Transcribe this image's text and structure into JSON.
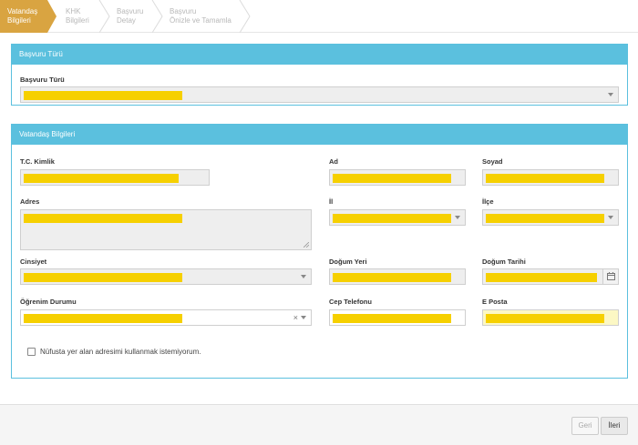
{
  "steps": [
    {
      "line1": "Vatandaş",
      "line2": "Bilgileri",
      "active": true
    },
    {
      "line1": "KHK",
      "line2": "Bilgileri",
      "active": false
    },
    {
      "line1": "Başvuru",
      "line2": "Detay",
      "active": false
    },
    {
      "line1": "Başvuru",
      "line2": "Önizle ve Tamamla",
      "active": false
    }
  ],
  "application_panel": {
    "title": "Başvuru Türü",
    "field_label": "Başvuru Türü"
  },
  "citizen_panel": {
    "title": "Vatandaş Bilgileri",
    "labels": {
      "tc": "T.C. Kimlik",
      "ad": "Ad",
      "soyad": "Soyad",
      "adres": "Adres",
      "il": "İl",
      "ilce": "İlçe",
      "cinsiyet": "Cinsiyet",
      "dogum_yeri": "Doğum Yeri",
      "dogum_tarihi": "Doğum Tarihi",
      "ogrenim": "Öğrenim Durumu",
      "cep": "Cep Telefonu",
      "eposta": "E Posta"
    },
    "checkbox_label": "Nüfusta yer alan adresimi kullanmak istemiyorum.",
    "clear_symbol": "×"
  },
  "footer": {
    "back_label": "Geri",
    "next_label": "İleri"
  },
  "colors": {
    "accent": "#5bc0de",
    "active_step": "#d9a441",
    "redaction": "#f6d000"
  }
}
